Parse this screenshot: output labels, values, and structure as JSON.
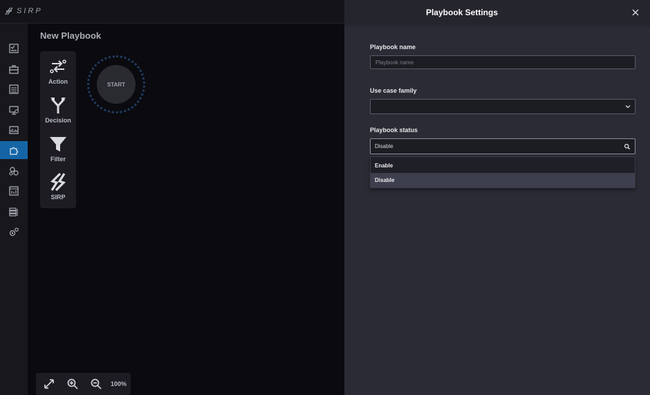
{
  "topbar": {
    "logo_text": "SIRP"
  },
  "nav": {
    "items": [
      {
        "icon": "checklist-icon"
      },
      {
        "icon": "briefcase-icon"
      },
      {
        "icon": "list-icon"
      },
      {
        "icon": "monitor-icon"
      },
      {
        "icon": "chart-icon"
      },
      {
        "icon": "puzzle-icon",
        "active": true
      },
      {
        "icon": "gears-icon"
      },
      {
        "icon": "report-icon"
      },
      {
        "icon": "server-icon"
      },
      {
        "icon": "settings-icon"
      }
    ],
    "active_color": "#1565a6"
  },
  "canvas": {
    "title": "New Playbook",
    "tools": [
      {
        "label": "Action"
      },
      {
        "label": "Decision"
      },
      {
        "label": "Filter"
      },
      {
        "label": "SIRP"
      }
    ],
    "start_label": "START",
    "zoom_level": "100%"
  },
  "panel": {
    "title": "Playbook Settings",
    "name_label": "Playbook name",
    "name_placeholder": "Playbook name",
    "name_value": "",
    "family_label": "Use case family",
    "family_value": "",
    "status_label": "Playbook status",
    "status_value": "Disable",
    "status_options": [
      "Enable",
      "Disable"
    ]
  }
}
